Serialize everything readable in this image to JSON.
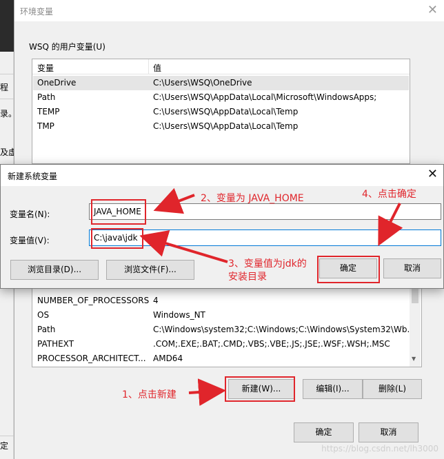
{
  "env_dialog": {
    "title": "环境变量",
    "user_group_label": "WSQ 的用户变量(U)",
    "user_columns": [
      "变量",
      "值"
    ],
    "user_vars": [
      {
        "name": "OneDrive",
        "value": "C:\\Users\\WSQ\\OneDrive"
      },
      {
        "name": "Path",
        "value": "C:\\Users\\WSQ\\AppData\\Local\\Microsoft\\WindowsApps;"
      },
      {
        "name": "TEMP",
        "value": "C:\\Users\\WSQ\\AppData\\Local\\Temp"
      },
      {
        "name": "TMP",
        "value": "C:\\Users\\WSQ\\AppData\\Local\\Temp"
      }
    ],
    "system_vars": [
      {
        "name": "NUMBER_OF_PROCESSORS",
        "value": "4"
      },
      {
        "name": "OS",
        "value": "Windows_NT"
      },
      {
        "name": "Path",
        "value": "C:\\Windows\\system32;C:\\Windows;C:\\Windows\\System32\\Wb..."
      },
      {
        "name": "PATHEXT",
        "value": ".COM;.EXE;.BAT;.CMD;.VBS;.VBE;.JS;.JSE;.WSF;.WSH;.MSC"
      },
      {
        "name": "PROCESSOR_ARCHITECT...",
        "value": "AMD64"
      }
    ],
    "new_button": "新建(W)...",
    "edit_button": "编辑(I)...",
    "delete_button": "删除(L)",
    "ok_button": "确定",
    "cancel_button": "取消"
  },
  "new_var_dialog": {
    "title": "新建系统变量",
    "name_label": "变量名(N):",
    "name_value": "JAVA_HOME",
    "value_label": "变量值(V):",
    "value_value": "C:\\java\\jdk",
    "browse_dir_button": "浏览目录(D)...",
    "browse_file_button": "浏览文件(F)...",
    "ok_button": "确定",
    "cancel_button": "取消"
  },
  "background_fragments": [
    "程",
    "录。",
    "及虚",
    "定"
  ],
  "annotations": {
    "step1": "1、点击新建",
    "step2": "2、变量为 JAVA_HOME",
    "step3": "3、变量值为jdk的\n安装目录",
    "step4": "4、点击确定"
  },
  "watermark": "https://blog.csdn.net/lh3000",
  "colors": {
    "annotation": "#e0252b",
    "focus": "#0078d7",
    "dialog_bg": "#f0f0f0"
  }
}
